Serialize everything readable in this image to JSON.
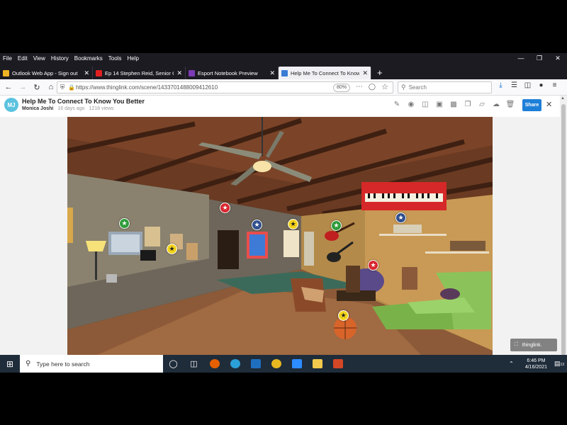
{
  "menubar": {
    "items": [
      "File",
      "Edit",
      "View",
      "History",
      "Bookmarks",
      "Tools",
      "Help"
    ]
  },
  "tabs": [
    {
      "title": "Outlook Web App - Sign out",
      "fav_color": "#f0b323"
    },
    {
      "title": "Ep 14 Stephen Reid, Senior Cur",
      "fav_color": "#e02020"
    },
    {
      "title": "Esport Notebook Preview",
      "fav_color": "#7b3bb5"
    },
    {
      "title": "Help Me To Connect To Know",
      "fav_color": "#3a7bd5"
    }
  ],
  "newtab_label": "+",
  "nav": {
    "url": "https://www.thinglink.com/scene/1433701488009412610",
    "zoom": "80%",
    "search_placeholder": "Search"
  },
  "page": {
    "avatar_initials": "MJ",
    "title": "Help Me To Connect To Know You Better",
    "author": "Monica Joshi",
    "age": "16 days ago",
    "views": "1218 views",
    "share_label": "Share",
    "badge_label": "thinglink."
  },
  "hotspots": [
    {
      "color": "green",
      "symbol": "★"
    },
    {
      "color": "red",
      "symbol": "★"
    },
    {
      "color": "blue",
      "symbol": "★"
    },
    {
      "color": "yellow",
      "symbol": "★"
    },
    {
      "color": "green",
      "symbol": "★"
    },
    {
      "color": "blue",
      "symbol": "★"
    },
    {
      "color": "yellow",
      "symbol": "★"
    },
    {
      "color": "red",
      "symbol": "★"
    },
    {
      "color": "yellow",
      "symbol": "★"
    }
  ],
  "taskbar": {
    "search_placeholder": "Type here to search",
    "time": "6:46 PM",
    "date": "4/16/2021",
    "notif_count": "13"
  }
}
